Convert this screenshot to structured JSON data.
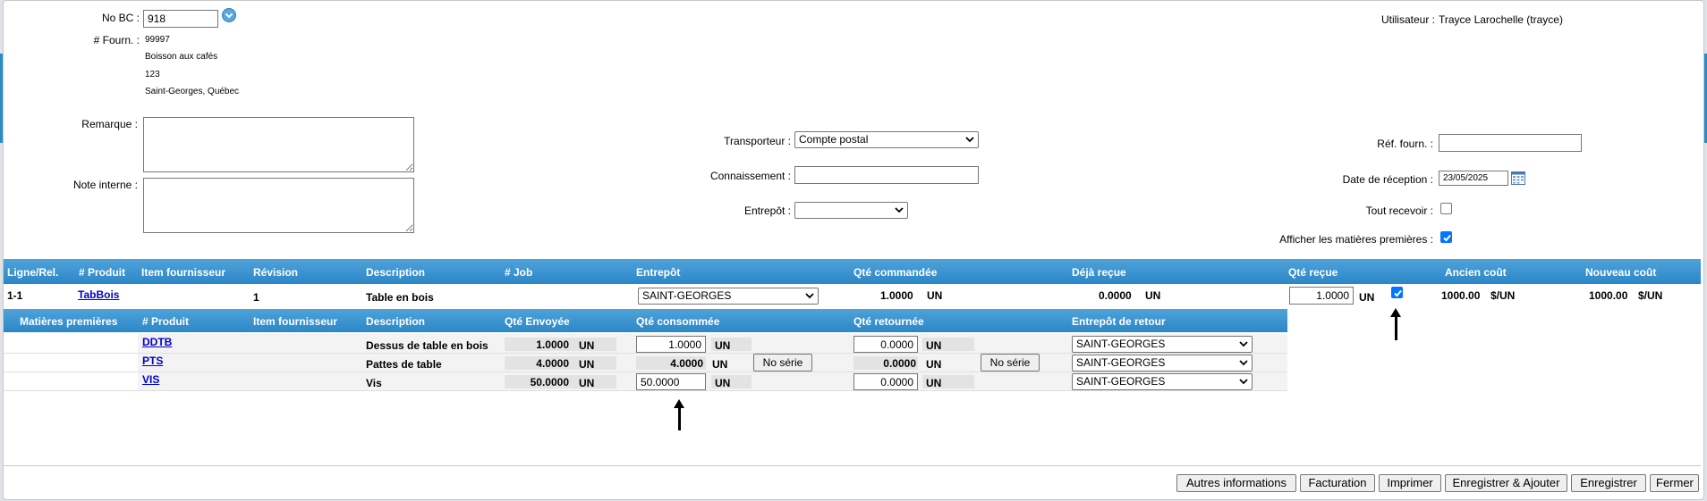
{
  "header": {
    "no_bc_label": "No BC :",
    "no_bc_value": "918",
    "fourn_label": "# Fourn. :",
    "fourn_code": "99997",
    "fourn_name": "Boisson aux cafés",
    "fourn_addr1": "123",
    "fourn_addr2": "Saint-Georges, Québec",
    "user_label": "Utilisateur :",
    "user_value": "Trayce Larochelle (trayce)"
  },
  "form": {
    "remarque_label": "Remarque :",
    "note_label": "Note interne :",
    "transporteur_label": "Transporteur :",
    "transporteur_value": "Compte postal",
    "connaissement_label": "Connaissement :",
    "entrepot_label": "Entrepôt :",
    "ref_label": "Réf. fourn. :",
    "date_label": "Date de réception :",
    "date_value": "23/05/2025",
    "tout_label": "Tout recevoir :",
    "afficher_label": "Afficher les matières premières :"
  },
  "table": {
    "headers": [
      "Ligne/Rel.",
      "# Produit",
      "Item fournisseur",
      "Révision",
      "Description",
      "# Job",
      "Entrepôt",
      "Qté commandée",
      "Déjà reçue",
      "Qté reçue",
      "Ancien coût",
      "Nouveau coût"
    ],
    "row": {
      "ligne": "1-1",
      "produit": "TabBois",
      "revision": "1",
      "description": "Table en bois",
      "entrepot": "SAINT-GEORGES",
      "qte_cmd": "1.0000",
      "qte_cmd_unit": "UN",
      "deja": "0.0000",
      "deja_unit": "UN",
      "qte_recue": "1.0000",
      "qte_recue_unit": "UN",
      "ancien": "1000.00",
      "ancien_unit": "$/UN",
      "nouveau": "1000.00",
      "nouveau_unit": "$/UN"
    },
    "sub_headers": [
      "Matières premières",
      "# Produit",
      "Item fournisseur",
      "Description",
      "Qté Envoyée",
      "Qté consommée",
      "Qté retournée",
      "Entrepôt de retour"
    ],
    "materials": [
      {
        "produit": "DDTB",
        "description": "Dessus de table en bois",
        "envoyee": "1.0000",
        "unit": "UN",
        "consommee": "1.0000",
        "retournee": "0.0000",
        "entrepot": "SAINT-GEORGES"
      },
      {
        "produit": "PTS",
        "description": "Pattes de table",
        "envoyee": "4.0000",
        "unit": "UN",
        "consommee": "4.0000",
        "retournee": "0.0000",
        "entrepot": "SAINT-GEORGES",
        "serie1": "No série",
        "serie2": "No série"
      },
      {
        "produit": "VIS",
        "description": "Vis",
        "envoyee": "50.0000",
        "unit": "UN",
        "consommee": "50.0000",
        "retournee": "0.0000",
        "entrepot": "SAINT-GEORGES"
      }
    ]
  },
  "footer": {
    "autres": "Autres informations",
    "facturation": "Facturation",
    "imprimer": "Imprimer",
    "enr_ajouter": "Enregistrer & Ajouter",
    "enregistrer": "Enregistrer",
    "fermer": "Fermer"
  },
  "colors": {
    "header_blue": "#2b87c7",
    "checkbox_blue": "#0075ff"
  },
  "icons": [
    "chevron-down-circle-icon",
    "calendar-icon",
    "arrow-up-icon"
  ]
}
